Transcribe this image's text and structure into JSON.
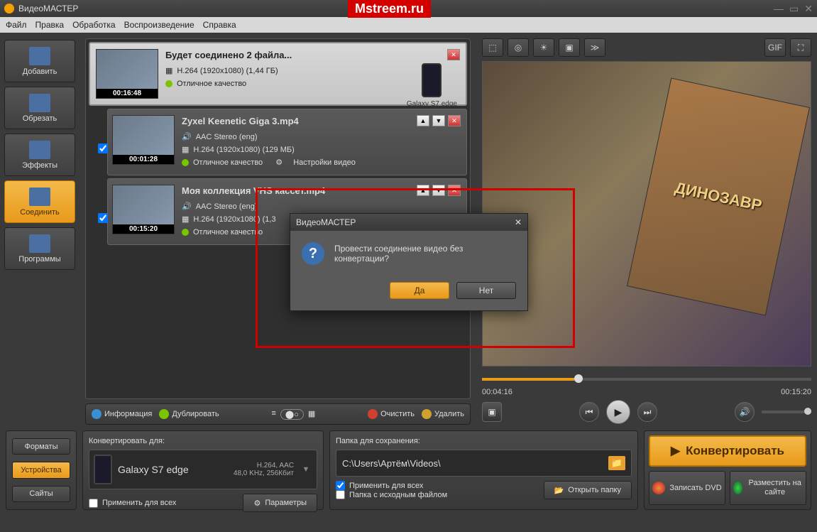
{
  "watermark": "Mstreem.ru",
  "app": {
    "title": "ВидеоМАСТЕР"
  },
  "menu": [
    "Файл",
    "Правка",
    "Обработка",
    "Воспроизведение",
    "Справка"
  ],
  "sidebar": [
    {
      "label": "Добавить"
    },
    {
      "label": "Обрезать"
    },
    {
      "label": "Эффекты"
    },
    {
      "label": "Соединить"
    },
    {
      "label": "Программы"
    }
  ],
  "merged": {
    "title": "Будет соединено 2 файла...",
    "codec_line": "H.264 (1920x1080) (1,44 ГБ)",
    "quality": "Отличное качество",
    "duration": "00:16:48",
    "device": "Galaxy S7 edge"
  },
  "files": [
    {
      "title": "Zyxel Keenetic Giga 3.mp4",
      "audio": "AAC Stereo (eng)",
      "video": "H.264 (1920x1080) (129 МБ)",
      "quality": "Отличное качество",
      "settings": "Настройки видео",
      "duration": "00:01:28"
    },
    {
      "title": "Моя коллекция VHS кассет.mp4",
      "audio": "AAC Stereo (eng)",
      "video": "H.264 (1920x1080) (1,3",
      "quality": "Отличное качество",
      "settings": "",
      "duration": "00:15:20"
    }
  ],
  "list_toolbar": {
    "info": "Информация",
    "dup": "Дублировать",
    "clear": "Очистить",
    "del": "Удалить"
  },
  "preview": {
    "dvd_text": "ДИНОЗАВР",
    "time_cur": "00:04:16",
    "time_total": "00:15:20"
  },
  "pv_tools_right": {
    "gif": "GIF"
  },
  "bottom": {
    "formats_tab": "Форматы",
    "devices_tab": "Устройства",
    "sites_tab": "Сайты",
    "convert_for": "Конвертировать для:",
    "device_name": "Galaxy S7 edge",
    "codec_info1": "H.264, AAC",
    "codec_info2": "48,0 KHz, 256Кбит",
    "apply_all1": "Применить для всех",
    "params": "Параметры",
    "save_folder_label": "Папка для сохранения:",
    "save_path": "C:\\Users\\Артём\\Videos\\",
    "apply_all2": "Применить для всех",
    "src_folder": "Папка с исходным файлом",
    "open_folder": "Открыть папку",
    "convert": "Конвертировать",
    "burn_dvd": "Записать DVD",
    "publish": "Разместить на сайте"
  },
  "dialog": {
    "title": "ВидеоМАСТЕР",
    "message": "Провести соединение видео без конвертации?",
    "yes": "Да",
    "no": "Нет"
  }
}
